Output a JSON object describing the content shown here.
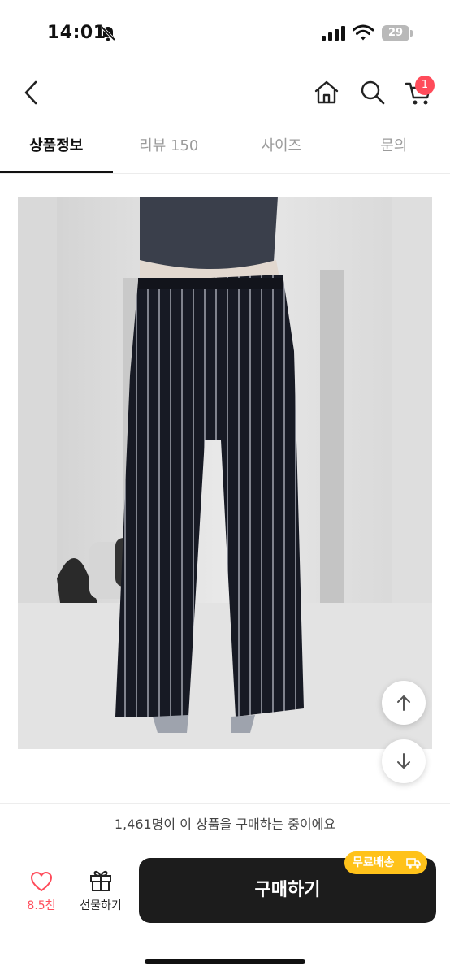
{
  "status_bar": {
    "time": "14:01",
    "battery_level": "29",
    "icons": [
      "bell-slash-icon",
      "signal-icon",
      "wifi-icon",
      "battery-icon"
    ]
  },
  "nav": {
    "icons": [
      "chevron-left-icon",
      "home-icon",
      "search-icon",
      "cart-icon"
    ],
    "cart_badge": "1"
  },
  "tabs": [
    {
      "label": "상품정보",
      "active": true
    },
    {
      "label": "리뷰 150",
      "active": false
    },
    {
      "label": "사이즈",
      "active": false
    },
    {
      "label": "문의",
      "active": false
    }
  ],
  "product": {
    "image": "photo of person wearing black pinstripe wide-leg trousers"
  },
  "scroll_buttons": [
    "arrow-up-icon",
    "arrow-down-icon"
  ],
  "purchase_notice": "1,461명이 이 상품을 구매하는 중이에요",
  "bottom_bar": {
    "like_count": "8.5천",
    "gift_label": "선물하기",
    "buy_label": "구매하기",
    "free_shipping_label": "무료배송"
  },
  "colors": {
    "accent_red": "#ff4b5a",
    "buy_button": "#1c1c1c",
    "free_shipping_badge": "#ffc21a"
  }
}
